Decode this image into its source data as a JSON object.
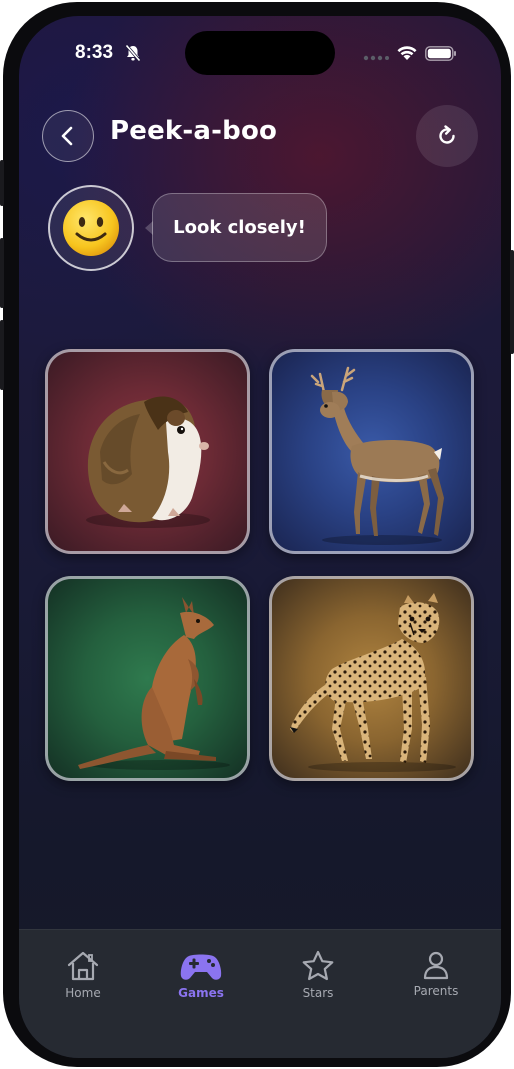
{
  "status_bar": {
    "time": "8:33",
    "icons": [
      "bell-slash-icon",
      "signal-dots-icon",
      "wifi-icon",
      "battery-icon"
    ]
  },
  "header": {
    "title": "Peek-a-boo",
    "back_icon": "chevron-left-icon",
    "refresh_icon": "refresh-icon"
  },
  "mascot": {
    "emoji": "🙂",
    "message": "Look closely!"
  },
  "cards": [
    {
      "animal": "guinea-pig",
      "color": "#7a2c38"
    },
    {
      "animal": "deer",
      "color": "#2f4a93"
    },
    {
      "animal": "kangaroo",
      "color": "#2a6b45"
    },
    {
      "animal": "cheetah",
      "color": "#9a7438"
    }
  ],
  "tabbar": {
    "active": "Games",
    "accent_color": "#8b74f0",
    "items": [
      {
        "label": "Home",
        "icon": "home-icon"
      },
      {
        "label": "Games",
        "icon": "gamepad-icon"
      },
      {
        "label": "Stars",
        "icon": "star-icon"
      },
      {
        "label": "Parents",
        "icon": "person-icon"
      }
    ]
  }
}
